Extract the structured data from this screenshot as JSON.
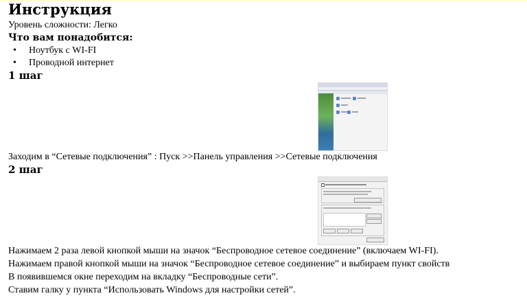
{
  "title": "Инструкция",
  "difficulty": "Уровень сложности: Легко",
  "requirements_heading": "Что вам понадобится:",
  "requirements": [
    "Ноутбук с WI-FI",
    "Проводной интернет"
  ],
  "bullet_char": "•",
  "steps": [
    {
      "heading": "1 шаг",
      "image_name": "control-panel-screenshot",
      "lines": [
        "Заходим в “Сетевые подключения” : Пуск >>Панель управления >>Сетевые подключения"
      ]
    },
    {
      "heading": "2 шаг",
      "image_name": "wireless-properties-screenshot",
      "lines": [
        "Нажимаем 2 раза левой кнопкой мыши на значок “Беспроводное сетевое соединение” (включаем WI-FI).",
        "Нажимаем правой кнопкой мыши на значок “Беспроводное сетевое соединение” и выбираем пункт свойств",
        "В появившемся окне переходим на вкладку “Беспроводные сети”.",
        "Ставим галку у пункта “Использовать Windows для настройки сетей”."
      ]
    }
  ]
}
